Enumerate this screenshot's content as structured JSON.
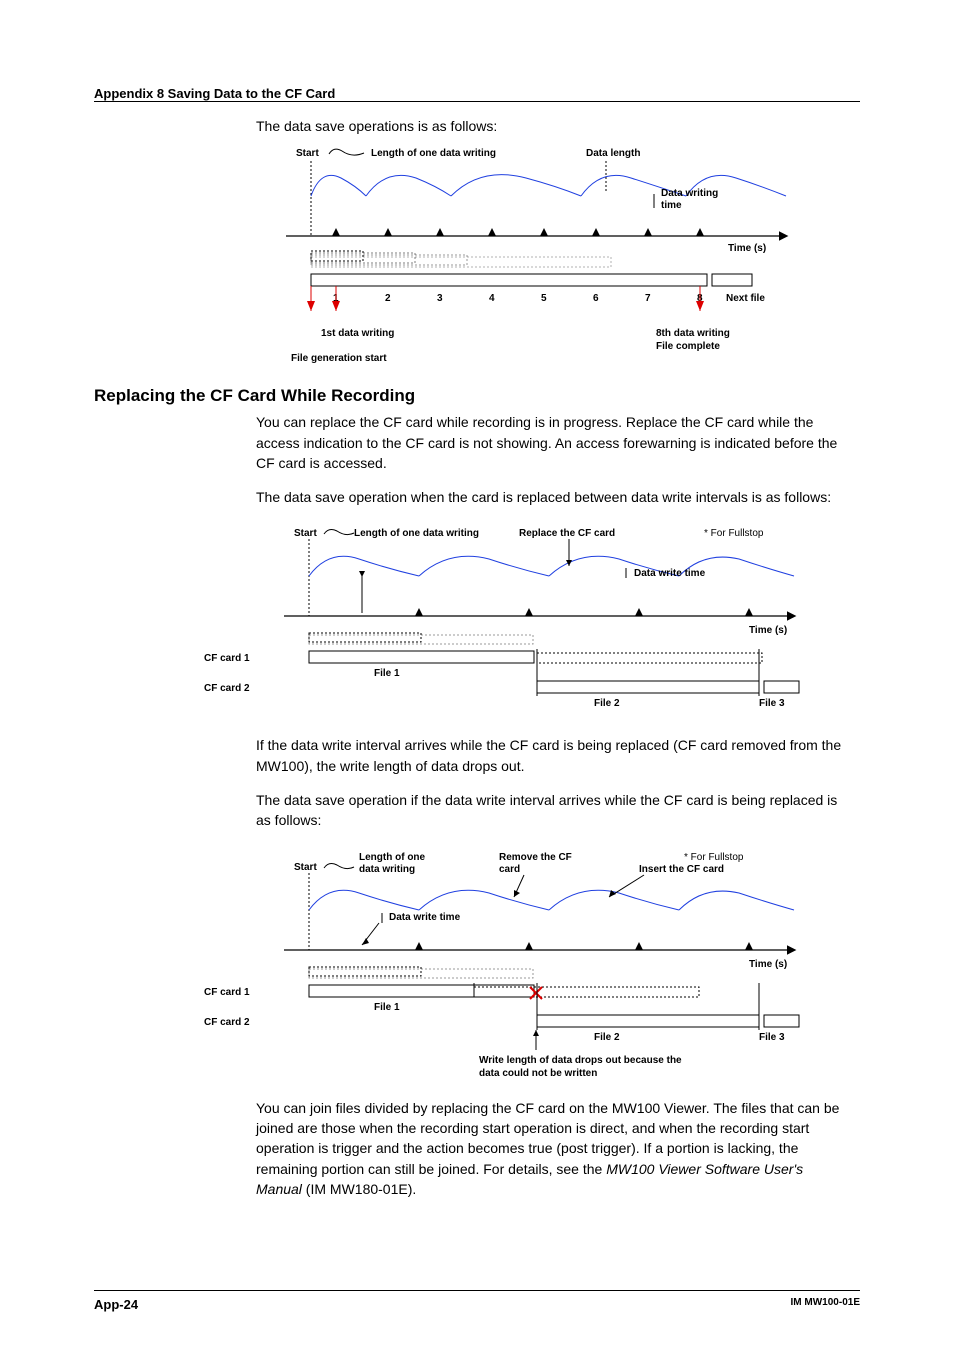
{
  "header": {
    "title": "Appendix 8  Saving Data to the CF Card"
  },
  "intro1": "The data save operations is as follows:",
  "fig1": {
    "start": "Start",
    "length_label": "Length of one data writing",
    "data_length": "Data length",
    "data_writing_time_1": "Data writing",
    "data_writing_time_2": "time",
    "time_axis": "Time (s)",
    "ticks": [
      "1",
      "2",
      "3",
      "4",
      "5",
      "6",
      "7",
      "8"
    ],
    "next_file": "Next file",
    "first_write": "1st data writing",
    "file_gen": "File generation start",
    "eighth_1": "8th data writing",
    "eighth_2": "File complete"
  },
  "section": {
    "heading": "Replacing the CF Card While Recording",
    "p1": "You can replace the CF card while recording is in progress. Replace the CF card while the access indication to the CF card is not showing. An access forewarning is indicated before the CF card is accessed.",
    "p2": "The data save operation when the card is replaced between data write intervals is as follows:"
  },
  "fig2": {
    "start": "Start",
    "length_label": "Length of one data writing",
    "replace": "Replace the CF card",
    "fullstop": "* For Fullstop",
    "data_write_time": "Data write time",
    "time_axis": "Time (s)",
    "card1": "CF card 1",
    "card2": "CF card 2",
    "file1": "File 1",
    "file2": "File 2",
    "file3": "File 3"
  },
  "mid": {
    "p1": "If the data write interval arrives while the CF card is being replaced (CF card removed from the MW100), the write length of data drops out.",
    "p2": "The data save operation if the data write interval arrives while the CF card is being replaced is as follows:"
  },
  "fig3": {
    "start": "Start",
    "length_1": "Length of one",
    "length_2": "data writing",
    "remove_1": "Remove the CF",
    "remove_2": "card",
    "fullstop": "* For Fullstop",
    "insert": "Insert the CF card",
    "data_write_time": "Data write time",
    "time_axis": "Time (s)",
    "card1": "CF card 1",
    "card2": "CF card 2",
    "file1": "File 1",
    "file2": "File 2",
    "file3": "File 3",
    "drop_1": "Write length of data drops out because the",
    "drop_2": "data could not be written"
  },
  "closing": {
    "p1a": "You can join files divided by replacing the CF card on the MW100 Viewer. The files that can be joined are those when the recording start operation is direct, and when the recording start operation is trigger and the action becomes true (post trigger). If a portion is lacking, the remaining portion can still be joined. For details, see the ",
    "p1_italic": "MW100 Viewer Software User's Manual",
    "p1b": " (IM MW180-01E)."
  },
  "footer": {
    "left": "App-24",
    "right": "IM MW100-01E"
  },
  "chart_data": [
    {
      "type": "timeline-diagram",
      "title": "Data save operations",
      "axis": "Time (s)",
      "events": [
        "File generation start",
        "1st data writing",
        "2",
        "3",
        "4",
        "5",
        "6",
        "7",
        "8th data writing / File complete",
        "Next file"
      ],
      "annotations": [
        "Start",
        "Length of one data writing",
        "Data length",
        "Data writing time"
      ]
    },
    {
      "type": "timeline-diagram",
      "title": "Card replaced between data write intervals",
      "axis": "Time (s)",
      "rows": [
        "CF card 1",
        "CF card 2"
      ],
      "card1_files": [
        "File 1"
      ],
      "card2_files": [
        "File 2",
        "File 3"
      ],
      "annotations": [
        "Start",
        "Length of one data writing",
        "Replace the CF card",
        "* For Fullstop",
        "Data write time"
      ]
    },
    {
      "type": "timeline-diagram",
      "title": "Data write interval arrives while CF card is being replaced",
      "axis": "Time (s)",
      "rows": [
        "CF card 1",
        "CF card 2"
      ],
      "card1_files": [
        "File 1"
      ],
      "card2_files": [
        "File 2",
        "File 3"
      ],
      "dropout": true,
      "annotations": [
        "Start",
        "Length of one data writing",
        "Remove the CF card",
        "Insert the CF card",
        "* For Fullstop",
        "Data write time",
        "Write length of data drops out because the data could not be written"
      ]
    }
  ]
}
